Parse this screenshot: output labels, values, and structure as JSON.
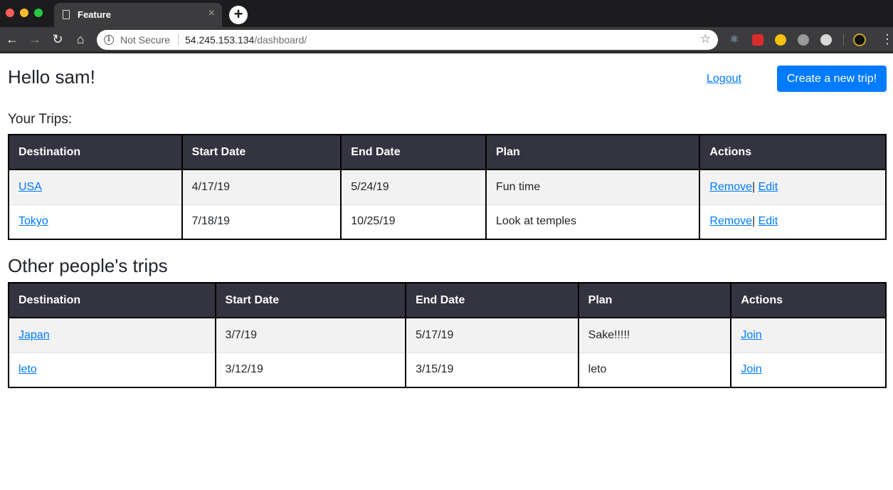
{
  "browser": {
    "tab_title": "Feature",
    "security_label": "Not Secure",
    "url_host": "54.245.153.134",
    "url_path": "/dashboard/"
  },
  "header": {
    "greeting": "Hello sam!",
    "logout": "Logout",
    "create_button": "Create a new trip!"
  },
  "your_trips": {
    "label": "Your Trips:",
    "columns": [
      "Destination",
      "Start Date",
      "End Date",
      "Plan",
      "Actions"
    ],
    "rows": [
      {
        "destination": "USA",
        "start": "4/17/19",
        "end": "5/24/19",
        "plan": "Fun time",
        "remove": "Remove",
        "sep": "|",
        "edit": "Edit"
      },
      {
        "destination": "Tokyo",
        "start": "7/18/19",
        "end": "10/25/19",
        "plan": "Look at temples",
        "remove": "Remove",
        "sep": "|",
        "edit": "Edit"
      }
    ]
  },
  "other_trips": {
    "heading": "Other people's trips",
    "columns": [
      "Destination",
      "Start Date",
      "End Date",
      "Plan",
      "Actions"
    ],
    "rows": [
      {
        "destination": "Japan",
        "start": "3/7/19",
        "end": "5/17/19",
        "plan": "Sake!!!!!",
        "join": "Join"
      },
      {
        "destination": "leto",
        "start": "3/12/19",
        "end": "3/15/19",
        "plan": "leto",
        "join": "Join"
      }
    ]
  },
  "colors": {
    "primary": "#007bff",
    "table_header_bg": "#343340",
    "striped_row_bg": "#f2f2f2"
  },
  "icons": [
    "page-icon",
    "close-icon",
    "plus-icon",
    "back-arrow-icon",
    "forward-arrow-icon",
    "reload-icon",
    "home-icon",
    "info-icon",
    "star-icon",
    "react-devtools-icon",
    "extension-icon",
    "menu-icon"
  ]
}
